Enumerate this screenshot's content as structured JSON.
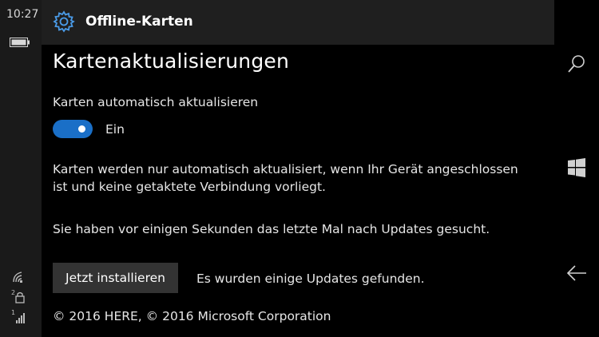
{
  "status_bar": {
    "time": "10:27",
    "battery_icon": "battery-icon",
    "wifi_icon": "wifi-icon",
    "sim2_icon": "sim2-lock-icon",
    "sim1_icon": "sim1-signal-icon",
    "sim2_number": "2",
    "sim1_number": "1"
  },
  "header": {
    "icon": "gear-icon",
    "title": "Offline-Karten"
  },
  "page": {
    "title": "Kartenaktualisierungen",
    "toggle_label": "Karten automatisch aktualisieren",
    "toggle_on": true,
    "toggle_state": "Ein",
    "info_text": "Karten werden nur automatisch aktualisiert, wenn Ihr Gerät angeschlossen ist und keine getaktete Verbindung vorliegt.",
    "last_check_text": "Sie haben vor einigen Sekunden das letzte Mal nach Updates gesucht.",
    "install_button": "Jetzt installieren",
    "update_status": "Es wurden einige Updates gefunden.",
    "copyright": "© 2016 HERE, © 2016 Microsoft Corporation"
  },
  "nav_bar": {
    "search_icon": "search-icon",
    "start_icon": "windows-icon",
    "back_icon": "back-arrow-icon"
  },
  "colors": {
    "accent": "#1a6fc7",
    "background": "#000000",
    "header_bg": "#1f1f1f",
    "button_bg": "#333333"
  }
}
